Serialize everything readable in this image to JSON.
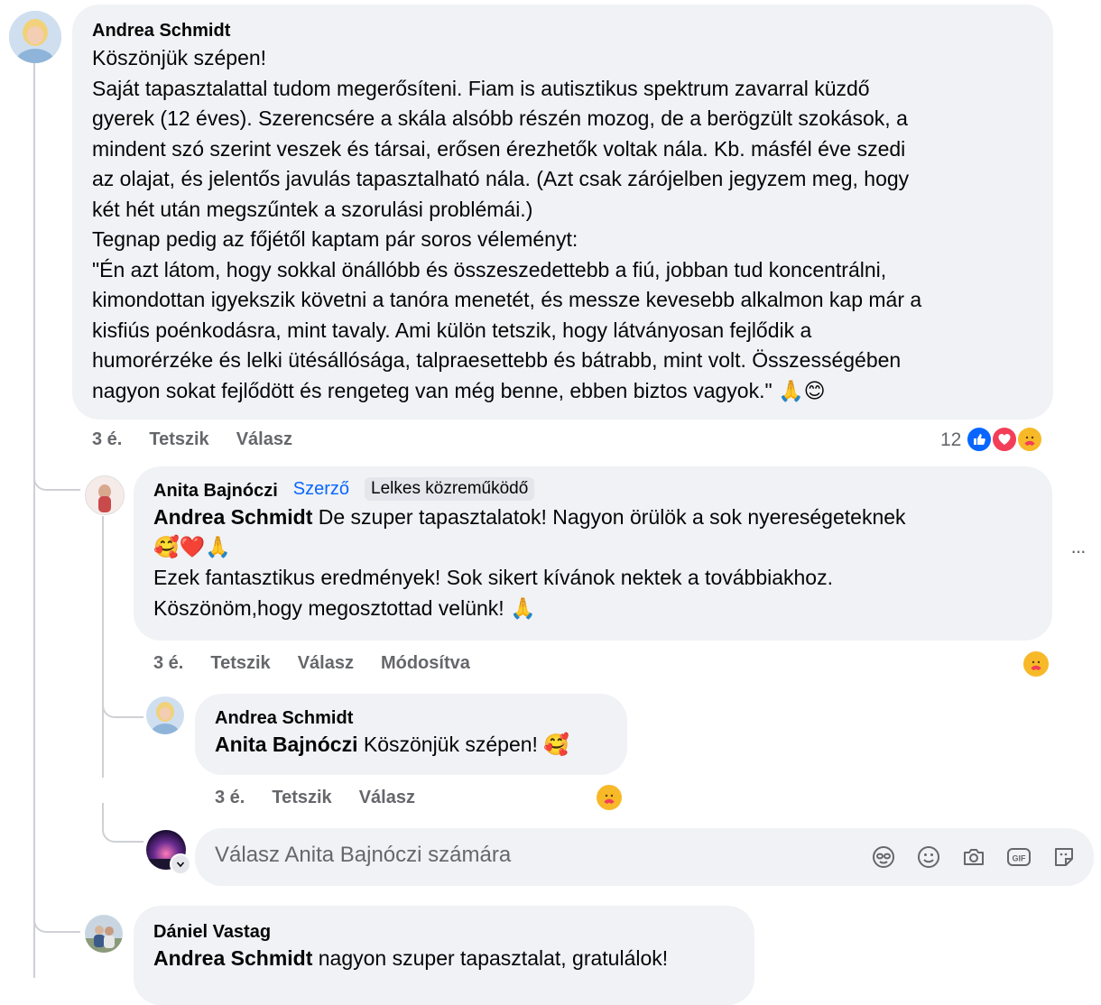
{
  "comment1": {
    "author": "Andrea Schmidt",
    "lines": [
      "Köszönjük szépen!",
      "Saját tapasztalattal tudom megerősíteni. Fiam is autisztikus spektrum zavarral küzdő",
      "gyerek (12 éves). Szerencsére a skála alsóbb részén mozog, de a berögzült szokások, a",
      "mindent szó szerint veszek és társai, erősen érezhetők voltak nála. Kb. másfél éve szedi",
      "az olajat, és jelentős javulás tapasztalható nála. (Azt csak zárójelben jegyzem meg, hogy",
      "két hét után megszűntek a szorulási problémái.)",
      "Tegnap pedig az főjétől kaptam pár soros véleményt:",
      "\"Én azt látom, hogy sokkal önállóbb és összeszedettebb a fiú, jobban tud koncentrálni,",
      "kimondottan igyekszik követni a tanóra menetét, és messze kevesebb alkalmon kap már a",
      "kisfiús poénkodásra, mint tavaly. Ami külön tetszik, hogy látványosan fejlődik a",
      "humorérzéke és lelki ütésállósága, talpraesettebb és bátrabb, mint volt. Összességében",
      "nagyon sokat fejlődött és rengeteg van még benne, ebben biztos vagyok.\" 🙏😊"
    ],
    "time": "3 é.",
    "like": "Tetszik",
    "reply": "Válasz",
    "reaction_count": "12"
  },
  "comment2": {
    "author": "Anita Bajnóczi",
    "badge_author": "Szerző",
    "badge_contributor": "Lelkes közreműködő",
    "mention": "Andrea Schmidt",
    "line1_rest": " De szuper tapasztalatok! Nagyon örülök a sok nyereségeteknek",
    "line2": "🥰❤️🙏",
    "line3": "Ezek fantasztikus eredmények! Sok sikert kívánok nektek a továbbiakhoz.",
    "line4": "Köszönöm,hogy megosztottad velünk! 🙏",
    "time": "3 é.",
    "like": "Tetszik",
    "reply": "Válasz",
    "edited": "Módosítva",
    "more": "···"
  },
  "comment3": {
    "author": "Andrea Schmidt",
    "mention": "Anita Bajnóczi",
    "text_rest": " Köszönjük szépen! 🥰",
    "time": "3 é.",
    "like": "Tetszik",
    "reply": "Válasz"
  },
  "reply_input": {
    "placeholder": "Válasz Anita Bajnóczi számára"
  },
  "comment4": {
    "author": "Dániel Vastag",
    "mention": "Andrea Schmidt",
    "text_rest": " nagyon szuper tapasztalat, gratulálok!"
  },
  "colors": {
    "bubble": "#f0f2f5",
    "secondary_text": "#65676b",
    "author_badge": "#0866ff",
    "like_blue": "#0866ff",
    "love_red": "#f33e58",
    "care_yellow": "#f7b928"
  }
}
